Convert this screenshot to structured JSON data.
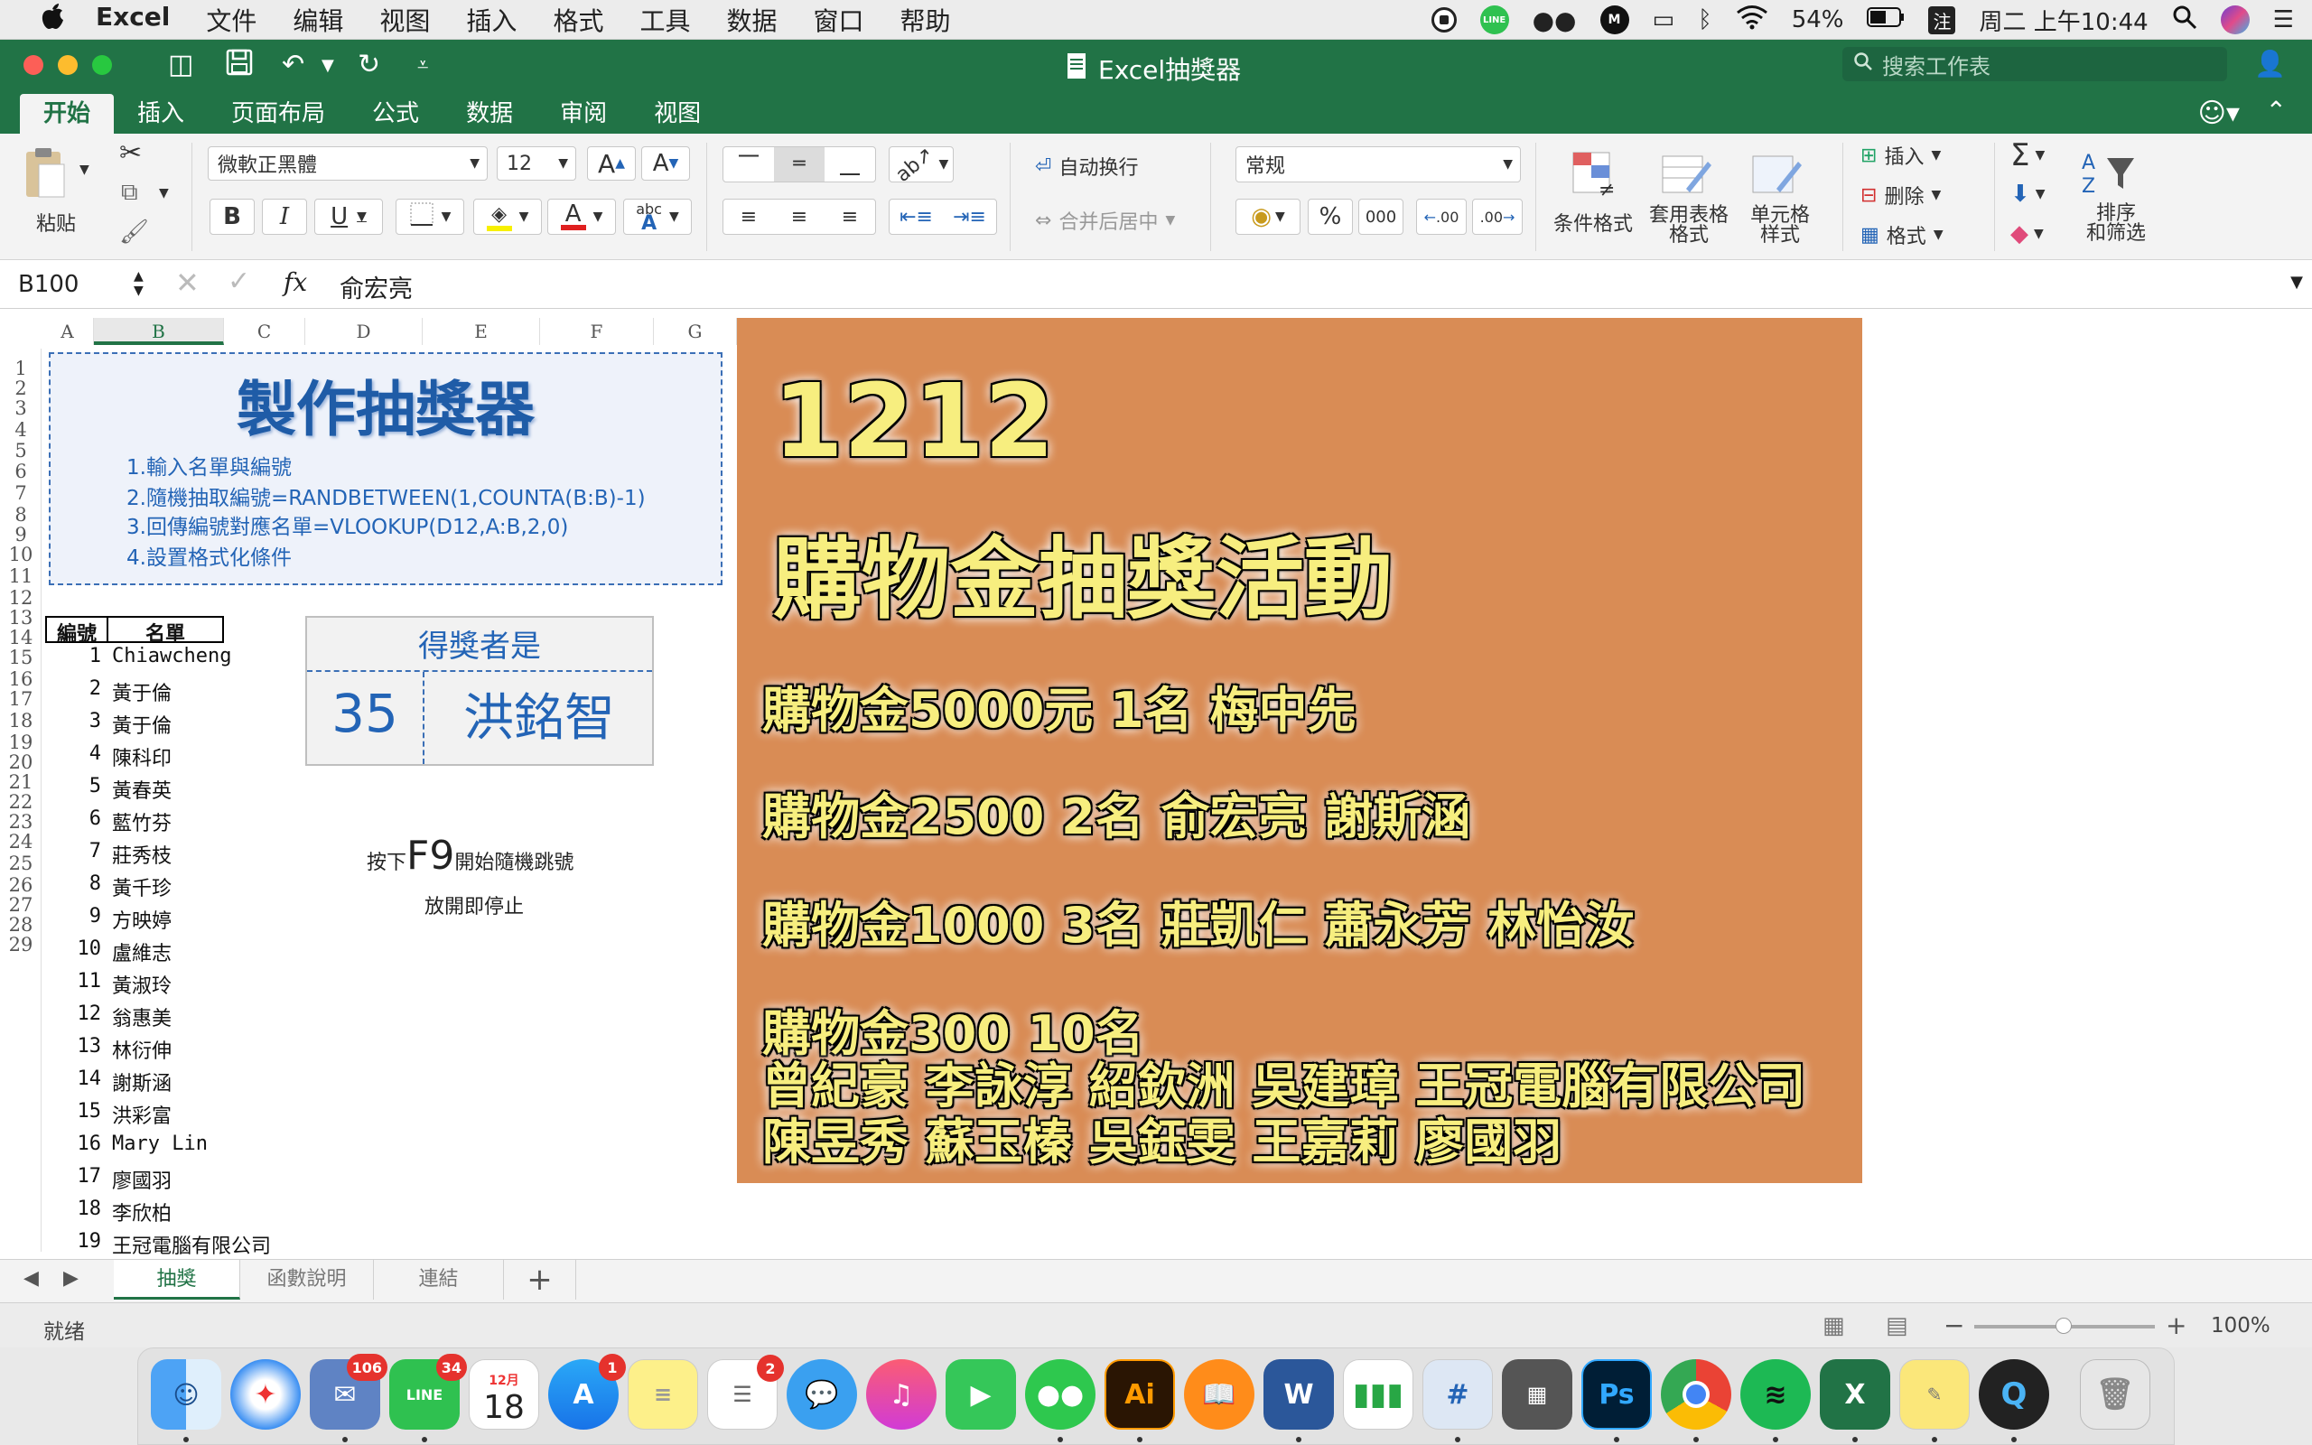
{
  "menubar": {
    "apple": "",
    "items": [
      "Excel",
      "文件",
      "编辑",
      "视图",
      "插入",
      "格式",
      "工具",
      "数据",
      "窗口",
      "帮助"
    ],
    "battery": "54%",
    "clock": "周二 上午10:44",
    "line_label": "LINE",
    "m_label": "M"
  },
  "window": {
    "title": "Excel抽獎器",
    "search_placeholder": "搜索工作表"
  },
  "ribbon_tabs": [
    "开始",
    "插入",
    "页面布局",
    "公式",
    "数据",
    "审阅",
    "视图"
  ],
  "ribbon": {
    "paste": "粘贴",
    "font_name": "微軟正黑體",
    "font_size": "12",
    "bold": "B",
    "italic": "I",
    "underline": "U",
    "grow_font": "A",
    "shrink_font": "A",
    "font_color_glyph": "A",
    "phonetic": "abc",
    "wrap_text": "自动换行",
    "merge_center": "合并后居中",
    "number_format": "常规",
    "percent": "%",
    "thousands": "000",
    "inc_decimal": ".00",
    "dec_decimal": ".00",
    "conditional_format": "条件格式",
    "table_format_1": "套用表格",
    "table_format_2": "格式",
    "cell_style_1": "单元格",
    "cell_style_2": "样式",
    "insert": "插入",
    "delete": "删除",
    "format": "格式",
    "sort_filter_1": "排序",
    "sort_filter_2": "和筛选",
    "sum_glyph": "Σ"
  },
  "formula_bar": {
    "name_box": "B100",
    "fx": "fx",
    "content": "俞宏亮"
  },
  "columns": [
    "A",
    "B",
    "C",
    "D",
    "E",
    "F",
    "G"
  ],
  "rows": [
    "1",
    "2",
    "3",
    "4",
    "5",
    "6",
    "7",
    "8",
    "9",
    "10",
    "11",
    "12",
    "13",
    "14",
    "15",
    "16",
    "17",
    "18",
    "19",
    "20",
    "21",
    "22",
    "23",
    "24",
    "25",
    "26",
    "27",
    "28",
    "29"
  ],
  "instructions": {
    "title": "製作抽獎器",
    "steps": [
      "1.輸入名單與編號",
      "2.隨機抽取編號=RANDBETWEEN(1,COUNTA(B:B)-1)",
      "3.回傳編號對應名單=VLOOKUP(D12,A:B,2,0)",
      "4.設置格式化條件"
    ]
  },
  "table": {
    "header_no": "編號",
    "header_name": "名單",
    "rows": [
      {
        "no": "1",
        "name": "Chiawcheng"
      },
      {
        "no": "2",
        "name": "黃于倫"
      },
      {
        "no": "3",
        "name": "黃于倫"
      },
      {
        "no": "4",
        "name": "陳科印"
      },
      {
        "no": "5",
        "name": "黃春英"
      },
      {
        "no": "6",
        "name": "藍竹芬"
      },
      {
        "no": "7",
        "name": "莊秀枝"
      },
      {
        "no": "8",
        "name": "黃千珍"
      },
      {
        "no": "9",
        "name": "方映婷"
      },
      {
        "no": "10",
        "name": "盧維志"
      },
      {
        "no": "11",
        "name": "黃淑玲"
      },
      {
        "no": "12",
        "name": "翁惠美"
      },
      {
        "no": "13",
        "name": "林衍伸"
      },
      {
        "no": "14",
        "name": "謝斯涵"
      },
      {
        "no": "15",
        "name": "洪彩富"
      },
      {
        "no": "16",
        "name": "Mary  Lin"
      },
      {
        "no": "17",
        "name": "廖國羽"
      },
      {
        "no": "18",
        "name": "李欣柏"
      },
      {
        "no": "19",
        "name": "王冠電腦有限公司"
      }
    ]
  },
  "winner": {
    "label": "得獎者是",
    "number": "35",
    "name": "洪銘智"
  },
  "hint": {
    "prefix": "按下",
    "key": "F9",
    "suffix": "開始隨機跳號",
    "line2": "放開即停止"
  },
  "prize": {
    "date": "1212",
    "title": "購物金抽獎活動",
    "line1": "購物金5000元 1名 梅中先",
    "line2": "購物金2500 2名 俞宏亮 謝斯涵",
    "line3": "購物金1000 3名 莊凱仁 蕭永芳 林怡汝",
    "line4": "購物金300 10名",
    "line5": "曾紀豪 李詠淳 紹欽洲 吳建璋  王冠電腦有限公司",
    "line6": "陳昱秀  蘇玉榛 吳鈺雯 王嘉莉 廖國羽"
  },
  "sheet_tabs": [
    "抽獎",
    "函數說明",
    "連結"
  ],
  "status": {
    "ready": "就绪",
    "zoom": "100%"
  },
  "dock": {
    "badges": {
      "mail": "106",
      "line": "34",
      "appstore": "1",
      "reminders": "2"
    },
    "calendar_month": "12月",
    "calendar_day": "18",
    "line_label": "LINE",
    "ai_label": "Ai",
    "ps_label": "Ps",
    "word_label": "W",
    "excel_label": "X"
  },
  "colors": {
    "excel_green": "#217346",
    "prize_bg": "#d98c55",
    "prize_text": "#f7ee7f",
    "accent_blue": "#2364b6"
  }
}
